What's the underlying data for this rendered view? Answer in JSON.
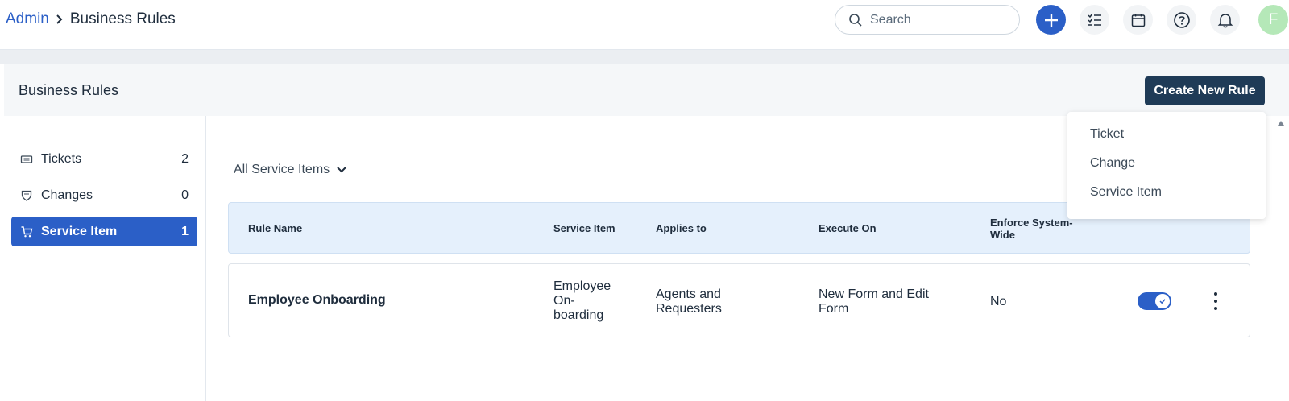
{
  "breadcrumb": {
    "parent": "Admin",
    "current": "Business Rules"
  },
  "search": {
    "placeholder": "Search"
  },
  "user": {
    "avatar_initial": "F"
  },
  "colors": {
    "primary": "#2b5fc7",
    "dark_button": "#1f3b57",
    "header_row": "#e5f0fc"
  },
  "page": {
    "title": "Business Rules",
    "create_button": "Create New Rule"
  },
  "create_menu": {
    "items": [
      "Ticket",
      "Change",
      "Service Item"
    ]
  },
  "sidebar": {
    "items": [
      {
        "label": "Tickets",
        "count": "2",
        "icon": "ticket-icon"
      },
      {
        "label": "Changes",
        "count": "0",
        "icon": "change-icon"
      },
      {
        "label": "Service Item",
        "count": "1",
        "icon": "cart-icon",
        "active": true
      }
    ]
  },
  "filter": {
    "label": "All Service Items"
  },
  "table": {
    "columns": [
      "Rule Name",
      "Service Item",
      "Applies to",
      "Execute On",
      "Enforce System-Wide"
    ],
    "rows": [
      {
        "rule_name": "Employee Onboarding",
        "service_item": "Employee On-boarding",
        "applies_to": "Agents and Requesters",
        "execute_on": "New Form and Edit Form",
        "enforce": "No",
        "enabled": true
      }
    ]
  }
}
